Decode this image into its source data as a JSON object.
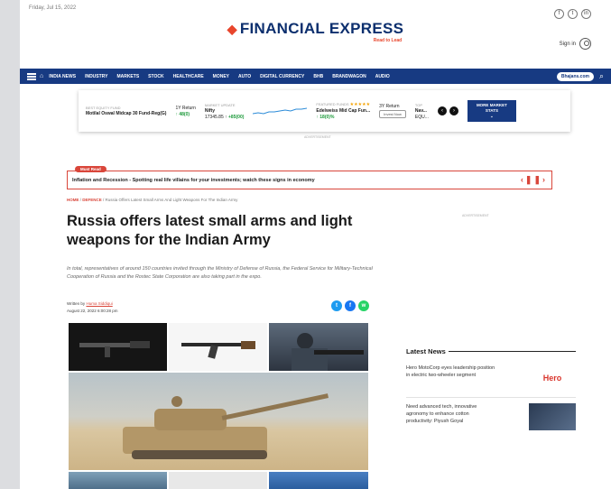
{
  "header": {
    "date": "Friday, Jul 15, 2022",
    "logo": "FINANCIAL EXPRESS",
    "tagline": "Read to Lead",
    "socials": [
      "f",
      "t",
      "in"
    ],
    "signin": "Sign in"
  },
  "nav": {
    "items": [
      "INDIA NEWS",
      "INDUSTRY",
      "MARKETS",
      "STOCK",
      "HEALTHCARE",
      "MONEY",
      "AUTO",
      "DIGITAL CURRENCY",
      "BHB",
      "BRANDWAGON",
      "AUDIO"
    ],
    "pill": "Bhajans.com"
  },
  "market": {
    "fund1": {
      "label": "BEST EQUITY FUND",
      "name": "Motilal Oswal Midcap 30 Fund-Reg(G)",
      "return_label": "1Y Return",
      "return": "↑ 48(0)"
    },
    "index": {
      "label": "MARKET UPDATE",
      "name": "Nifty",
      "value": "17345.85 ↑",
      "change": "+85(00)"
    },
    "fund2": {
      "label": "FEATURED FUNDS",
      "stars": "★★★★★",
      "name": "Edelweiss Mid Cap Fun...",
      "return_label": "3Y Return",
      "return": "↑ 18(0)%",
      "button": "Invest Now"
    },
    "fund3": {
      "label": "TOP",
      "name": "Nav...",
      "value": "EQU..."
    },
    "more": "MORE MARKET STATS"
  },
  "ad": {
    "label": "ADVERTISEMENT",
    "label_right": "ADVERTISEMENT"
  },
  "ticker": {
    "badge": "Must Read",
    "text": "Inflation and Recession - Spotting real life villains for your investments; watch these signs in economy"
  },
  "breadcrumb": {
    "home": "HOME",
    "section": "DEFENCE",
    "current": "Russia Offers Latest Small Arms And Light Weapons For The Indian Army"
  },
  "article": {
    "headline": "Russia offers latest small arms and light weapons for the Indian Army",
    "summary": "In total, representatives of around 150 countries invited through the Ministry of Defense of Russia, the Federal Service for Military-Technical Cooperation of Russia and the Rostec State Corporation are also taking part in the expo.",
    "written_by": "Written by",
    "author": "Huma Siddiqui",
    "date": "August 22, 2022 6:00:28 pm"
  },
  "share": {
    "twitter": "t",
    "facebook": "f",
    "whatsapp": "w"
  },
  "latest_news": {
    "title": "Latest News",
    "items": [
      {
        "text": "Hero MotoCorp eyes leadership position in electric two-wheeler segment",
        "thumb": "Hero"
      },
      {
        "text": "Need advanced tech, innovative agronomy to enhance cotton productivity: Piyush Goyal",
        "thumb": ""
      }
    ]
  },
  "colors": {
    "brand_blue": "#173a82",
    "accent_red": "#d9463a",
    "logo_navy": "#0c2f6e"
  }
}
